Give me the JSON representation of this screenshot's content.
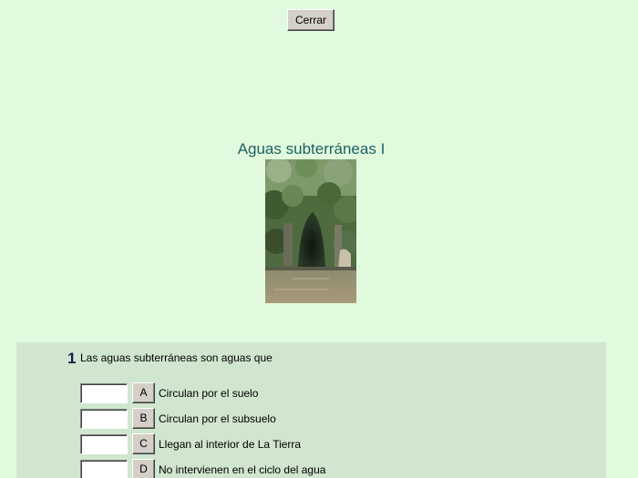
{
  "toolbar": {
    "close_label": "Cerrar"
  },
  "header": {
    "title": "Aguas subterráneas I"
  },
  "image": {
    "icon": "cave-photo"
  },
  "question": {
    "number": "1",
    "text": "Las aguas subterráneas son aguas que",
    "options": [
      {
        "letter": "A",
        "text": "Circulan por el suelo",
        "value": ""
      },
      {
        "letter": "B",
        "text": "Circulan por el subsuelo",
        "value": ""
      },
      {
        "letter": "C",
        "text": "Llegan al interior de La Tierra",
        "value": ""
      },
      {
        "letter": "D",
        "text": "No intervienen en el ciclo del agua",
        "value": ""
      }
    ]
  },
  "colors": {
    "background": "#e1fade",
    "panel": "#d0e6cf",
    "title": "#1f5f5f"
  }
}
